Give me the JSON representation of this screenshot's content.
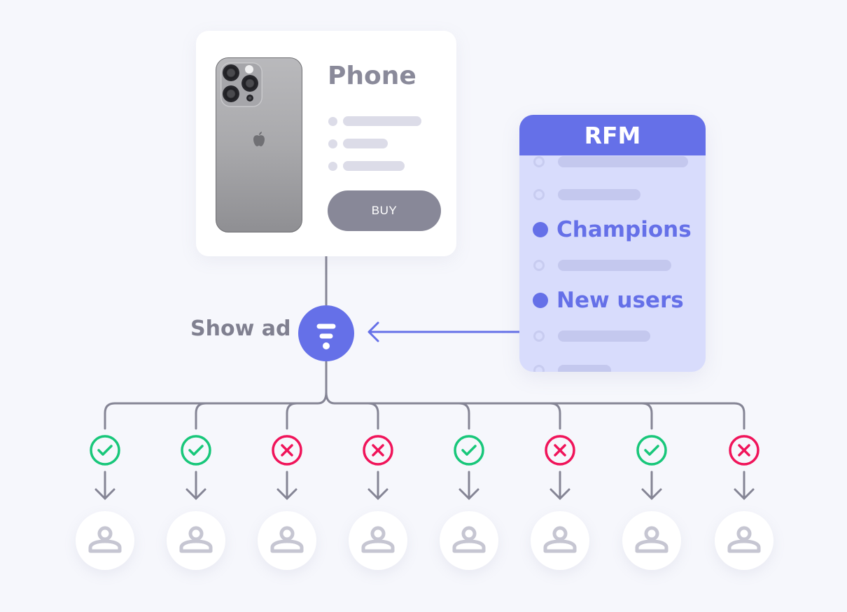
{
  "product_card": {
    "title": "Phone",
    "image_alt": "iPhone back view",
    "detail_lines": 3,
    "buy_label": "BUY"
  },
  "filter": {
    "label": "Show ad",
    "icon": "filter-icon",
    "color": "#6570e8"
  },
  "rfm_panel": {
    "title": "RFM",
    "segments": [
      {
        "label": "",
        "selected": false
      },
      {
        "label": "",
        "selected": false
      },
      {
        "label": "Champions",
        "selected": true
      },
      {
        "label": "",
        "selected": false
      },
      {
        "label": "New users",
        "selected": true
      },
      {
        "label": "",
        "selected": false
      },
      {
        "label": "",
        "selected": false
      }
    ]
  },
  "users": [
    {
      "status": "shown",
      "icon": "check-icon"
    },
    {
      "status": "shown",
      "icon": "check-icon"
    },
    {
      "status": "not-shown",
      "icon": "cross-icon"
    },
    {
      "status": "not-shown",
      "icon": "cross-icon"
    },
    {
      "status": "shown",
      "icon": "check-icon"
    },
    {
      "status": "not-shown",
      "icon": "cross-icon"
    },
    {
      "status": "shown",
      "icon": "check-icon"
    },
    {
      "status": "not-shown",
      "icon": "cross-icon"
    }
  ],
  "colors": {
    "accent": "#6570e8",
    "success": "#18c77a",
    "error": "#f0145a",
    "line": "#858595",
    "background": "#f6f7fc"
  }
}
